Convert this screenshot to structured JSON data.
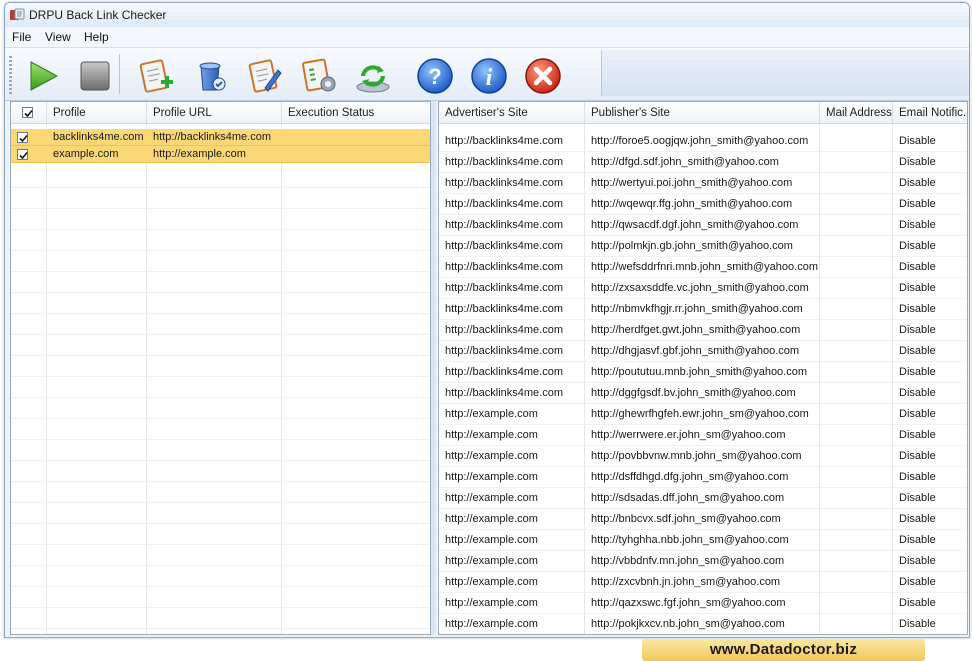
{
  "window": {
    "title": "DRPU Back Link Checker"
  },
  "menu": [
    "File",
    "View",
    "Help"
  ],
  "toolbar": {
    "buttons": [
      "start-icon",
      "stop-icon",
      "add-profile-icon",
      "delete-profile-icon",
      "edit-profile-icon",
      "settings-icon",
      "update-icon",
      "help-icon",
      "info-icon",
      "exit-icon"
    ]
  },
  "colors": {
    "selected_row": "#fbd775",
    "brand_bg": "#f2c75a"
  },
  "left_table": {
    "columns": [
      "Profile",
      "Profile URL",
      "Execution Status"
    ],
    "rows": [
      {
        "checked": true,
        "profile": "backlinks4me.com",
        "url": "http://backlinks4me.com",
        "status": ""
      },
      {
        "checked": true,
        "profile": "example.com",
        "url": "http://example.com",
        "status": ""
      }
    ]
  },
  "right_table": {
    "columns": [
      "Advertiser's Site",
      "Publisher's Site",
      "Mail Address",
      "Email Notific..."
    ],
    "rows": [
      [
        "http://backlinks4me.com",
        "http://foroe5.oogjqw.john_smith@yahoo.com",
        "",
        "Disable"
      ],
      [
        "http://backlinks4me.com",
        "http://dfgd.sdf.john_smith@yahoo.com",
        "",
        "Disable"
      ],
      [
        "http://backlinks4me.com",
        "http://wertyui.poi.john_smith@yahoo.com",
        "",
        "Disable"
      ],
      [
        "http://backlinks4me.com",
        "http://wqewqr.ffg.john_smith@yahoo.com",
        "",
        "Disable"
      ],
      [
        "http://backlinks4me.com",
        "http://qwsacdf.dgf.john_smith@yahoo.com",
        "",
        "Disable"
      ],
      [
        "http://backlinks4me.com",
        "http://polmkjn.gb.john_smith@yahoo.com",
        "",
        "Disable"
      ],
      [
        "http://backlinks4me.com",
        "http://wefsddrfnri.mnb.john_smith@yahoo.com",
        "",
        "Disable"
      ],
      [
        "http://backlinks4me.com",
        "http://zxsaxsddfe.vc.john_smith@yahoo.com",
        "",
        "Disable"
      ],
      [
        "http://backlinks4me.com",
        "http://nbmvkfhgjr.rr.john_smith@yahoo.com",
        "",
        "Disable"
      ],
      [
        "http://backlinks4me.com",
        "http://herdfget.gwt.john_smith@yahoo.com",
        "",
        "Disable"
      ],
      [
        "http://backlinks4me.com",
        "http://dhgjasvf.gbf.john_smith@yahoo.com",
        "",
        "Disable"
      ],
      [
        "http://backlinks4me.com",
        "http://poututuu.mnb.john_smith@yahoo.com",
        "",
        "Disable"
      ],
      [
        "http://backlinks4me.com",
        "http://dggfgsdf.bv.john_smith@yahoo.com",
        "",
        "Disable"
      ],
      [
        "http://example.com",
        "http://ghewrfhgfeh.ewr.john_sm@yahoo.com",
        "",
        "Disable"
      ],
      [
        "http://example.com",
        "http://werrwere.er.john_sm@yahoo.com",
        "",
        "Disable"
      ],
      [
        "http://example.com",
        "http://povbbvnw.mnb.john_sm@yahoo.com",
        "",
        "Disable"
      ],
      [
        "http://example.com",
        "http://dsffdhgd.dfg.john_sm@yahoo.com",
        "",
        "Disable"
      ],
      [
        "http://example.com",
        "http://sdsadas.dff.john_sm@yahoo.com",
        "",
        "Disable"
      ],
      [
        "http://example.com",
        "http://bnbcvx.sdf.john_sm@yahoo.com",
        "",
        "Disable"
      ],
      [
        "http://example.com",
        "http://tyhghha.nbb.john_sm@yahoo.com",
        "",
        "Disable"
      ],
      [
        "http://example.com",
        "http://vbbdnfv.mn.john_sm@yahoo.com",
        "",
        "Disable"
      ],
      [
        "http://example.com",
        "http://zxcvbnh.jn.john_sm@yahoo.com",
        "",
        "Disable"
      ],
      [
        "http://example.com",
        "http://qazxswc.fgf.john_sm@yahoo.com",
        "",
        "Disable"
      ],
      [
        "http://example.com",
        "http://pokjkxcv.nb.john_sm@yahoo.com",
        "",
        "Disable"
      ]
    ]
  },
  "brand": {
    "text": "www.Datadoctor.biz"
  }
}
